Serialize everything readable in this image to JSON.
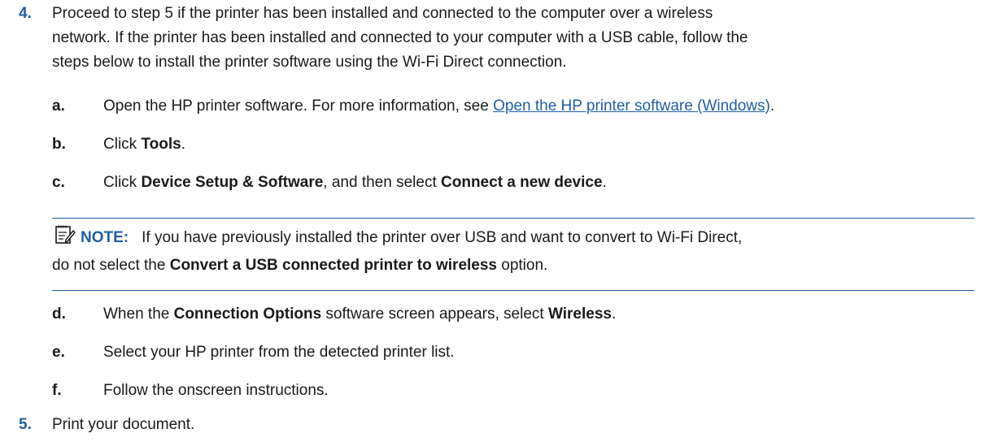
{
  "step4": {
    "number": "4.",
    "line1": "Proceed to step 5 if the printer has been installed and connected to the computer over a wireless",
    "line2": "network. If the printer has been installed and connected to your computer with a USB cable, follow the",
    "line3": "steps below to install the printer software using the Wi-Fi Direct connection."
  },
  "substeps": {
    "a": {
      "letter": "a.",
      "text": "Open the HP printer software. For more information, see ",
      "link": "Open the HP printer software (Windows)",
      "after": "."
    },
    "b": {
      "letter": "b.",
      "text": "Click ",
      "bold": "Tools",
      "after": "."
    },
    "c": {
      "letter": "c.",
      "text": "Click ",
      "bold1": "Device Setup & Software",
      "mid": ", and then select ",
      "bold2": "Connect a new device",
      "after": "."
    },
    "d": {
      "letter": "d.",
      "text": "When the ",
      "bold1": "Connection Options",
      "mid": " software screen appears, select ",
      "bold2": "Wireless",
      "after": "."
    },
    "e": {
      "letter": "e.",
      "text": "Select your HP printer from the detected printer list."
    },
    "f": {
      "letter": "f.",
      "text": "Follow the onscreen instructions."
    }
  },
  "note": {
    "icon": "note-pencil-icon",
    "label": "NOTE:",
    "line1": "If you have previously installed the printer over USB and want to convert to Wi-Fi Direct,",
    "line2_pre": "do not select the ",
    "line2_bold": "Convert a USB connected printer to wireless",
    "line2_post": " option."
  },
  "step5": {
    "number": "5.",
    "text": "Print your document."
  },
  "colors": {
    "accent": "#1f5fa3",
    "text": "#1a1a1a"
  }
}
